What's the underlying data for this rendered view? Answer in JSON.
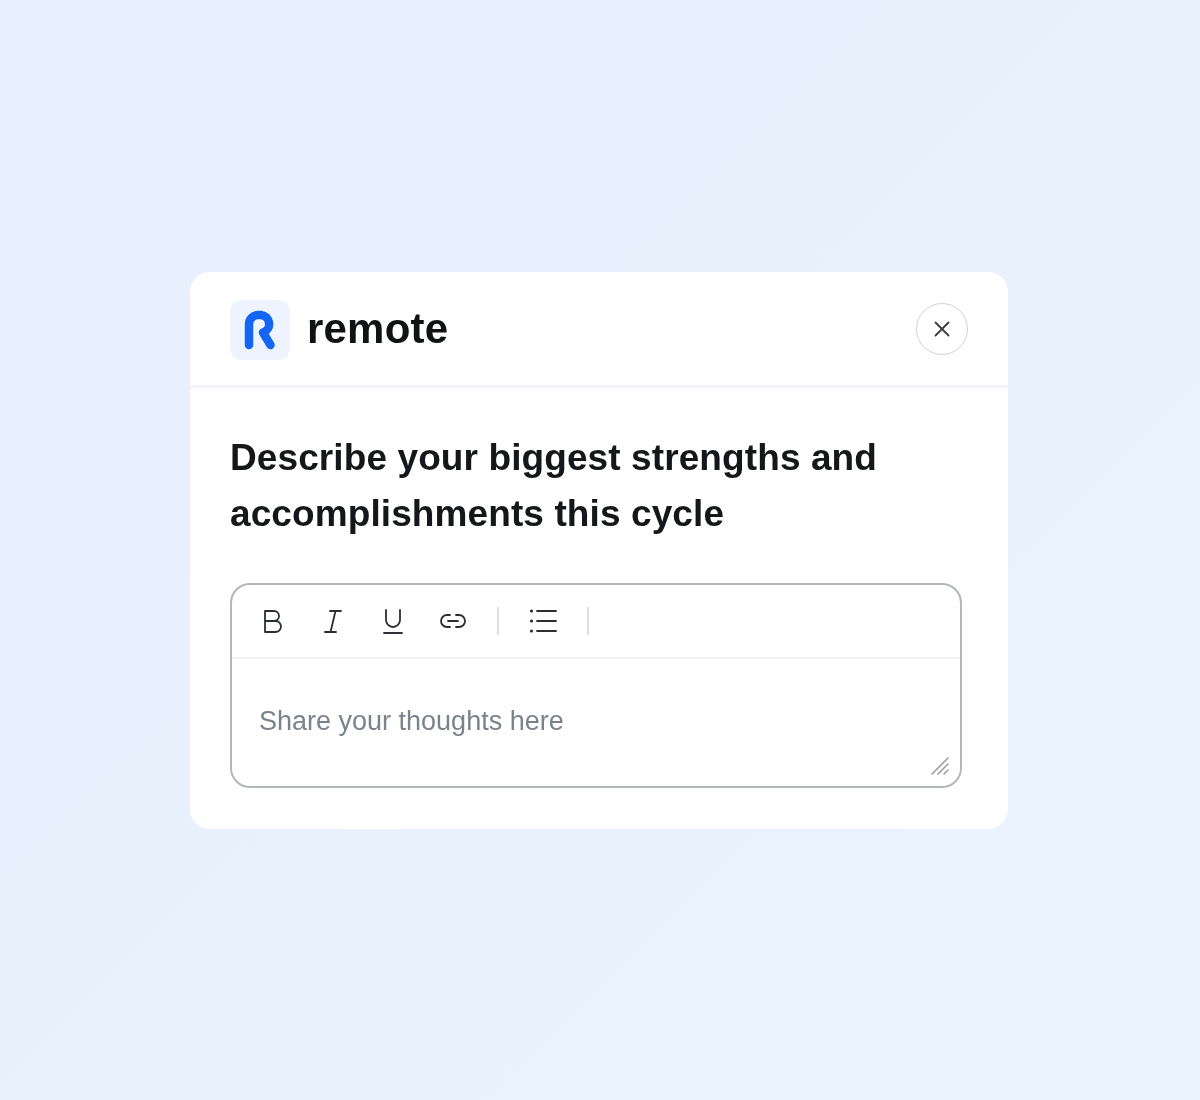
{
  "brand": {
    "name": "remote"
  },
  "question": {
    "text": "Describe your biggest strengths and accomplishments this cycle"
  },
  "editor": {
    "toolbar": [
      {
        "kind": "bold"
      },
      {
        "kind": "italic"
      },
      {
        "kind": "underline"
      },
      {
        "kind": "link"
      },
      {
        "kind": "separator"
      },
      {
        "kind": "bullet_list"
      },
      {
        "kind": "separator"
      }
    ],
    "placeholder": "Share your thoughts here"
  }
}
